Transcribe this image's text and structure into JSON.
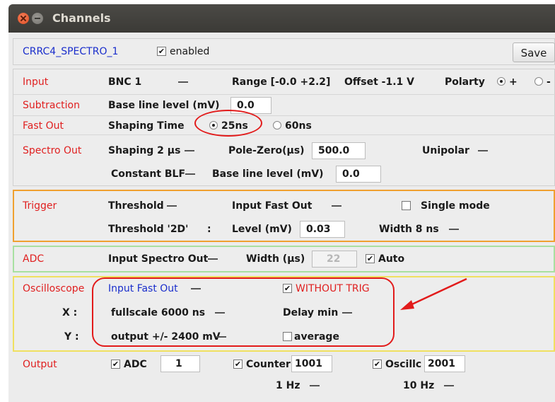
{
  "window": {
    "title": "Channels"
  },
  "header": {
    "channel_name": "CRRC4_SPECTRO_1",
    "enabled_label": "enabled",
    "enabled": true,
    "save_label": "Save"
  },
  "input": {
    "label": "Input",
    "source": "BNC 1",
    "range": "Range [-0.0 +2.2]",
    "offset": "Offset -1.1 V",
    "polarity_label": "Polarty",
    "polarity_plus": "+",
    "polarity_minus": "-"
  },
  "subtraction": {
    "label": "Subtraction",
    "baseline_label": "Base line level (mV)",
    "baseline_value": "0.0"
  },
  "fast_out": {
    "label": "Fast Out",
    "shaping_label": "Shaping Time",
    "opt_25": "25ns",
    "opt_60": "60ns",
    "selected": "25ns"
  },
  "spectro_out": {
    "label": "Spectro Out",
    "shaping": "Shaping  2 μs",
    "pole_zero_label": "Pole-Zero(μs)",
    "pole_zero_value": "500.0",
    "unipolar": "Unipolar",
    "constant_blf": "Constant BLF",
    "baseline_label": "Base line level (mV)",
    "baseline_value": "0.0"
  },
  "trigger": {
    "label": "Trigger",
    "threshold": "Threshold",
    "input": "Input Fast Out",
    "single_mode": "Single mode",
    "threshold_2d": "Threshold '2D'",
    "colon": ":",
    "level_label": "Level (mV)",
    "level_value": "0.03",
    "width": "Width  8 ns"
  },
  "adc": {
    "label": "ADC",
    "input": "Input Spectro Out",
    "width_label": "Width (μs)",
    "width_value": "22",
    "auto_label": "Auto"
  },
  "oscilloscope": {
    "label": "Oscilloscope",
    "input": "Input Fast Out",
    "without_trig": "WITHOUT TRIG",
    "x_label": "X :",
    "x_value": "fullscale 6000 ns",
    "delay": "Delay min",
    "y_label": "Y :",
    "y_value": "output +/- 2400 mV",
    "average": "average"
  },
  "output": {
    "label": "Output",
    "adc": "ADC",
    "adc_value": "1",
    "counter": "Counter",
    "counter_value": "1001",
    "counter_rate": "1 Hz",
    "oscillo": "Oscillc",
    "oscillo_value": "2001",
    "oscillo_rate": "10 Hz"
  },
  "colors": {
    "label_red": "#e02020",
    "link_blue": "#1a2ecc",
    "annotation": "#e21b1b",
    "trigger_border": "#f0a030",
    "adc_border": "#a8e0a0",
    "osc_border": "#f0e060"
  }
}
